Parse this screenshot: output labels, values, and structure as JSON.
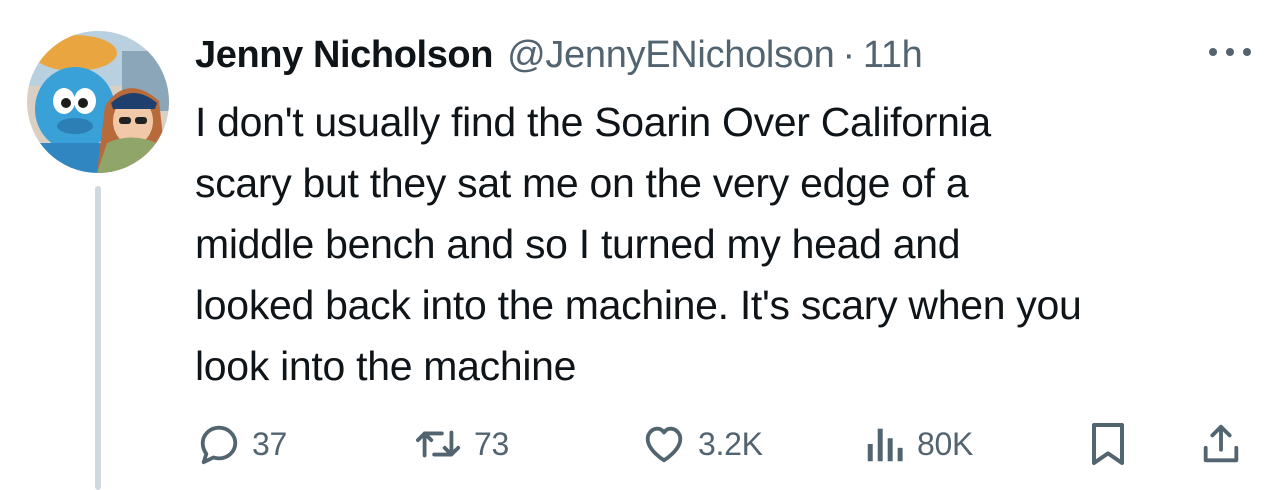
{
  "tweet": {
    "author": {
      "display_name": "Jenny Nicholson",
      "handle": "@JennyENicholson",
      "avatar": "avatar-photo"
    },
    "separator": "·",
    "timestamp": "11h",
    "text": "I don't usually find the Soarin Over California\nscary but they sat me on the very edge of a\nmiddle bench and so I turned my head and\nlooked back into the machine. It's scary when you\nlook into the machine",
    "more_icon": "more-horizontal-icon"
  },
  "actions": {
    "reply": {
      "icon": "reply-icon",
      "count": "37"
    },
    "retweet": {
      "icon": "retweet-icon",
      "count": "73"
    },
    "like": {
      "icon": "heart-icon",
      "count": "3.2K"
    },
    "views": {
      "icon": "analytics-icon",
      "count": "80K"
    },
    "bookmark": {
      "icon": "bookmark-icon"
    },
    "share": {
      "icon": "share-icon"
    }
  },
  "colors": {
    "text_primary": "#0f1419",
    "text_secondary": "#536471",
    "thread_line": "#cfd9de",
    "background": "#ffffff"
  }
}
